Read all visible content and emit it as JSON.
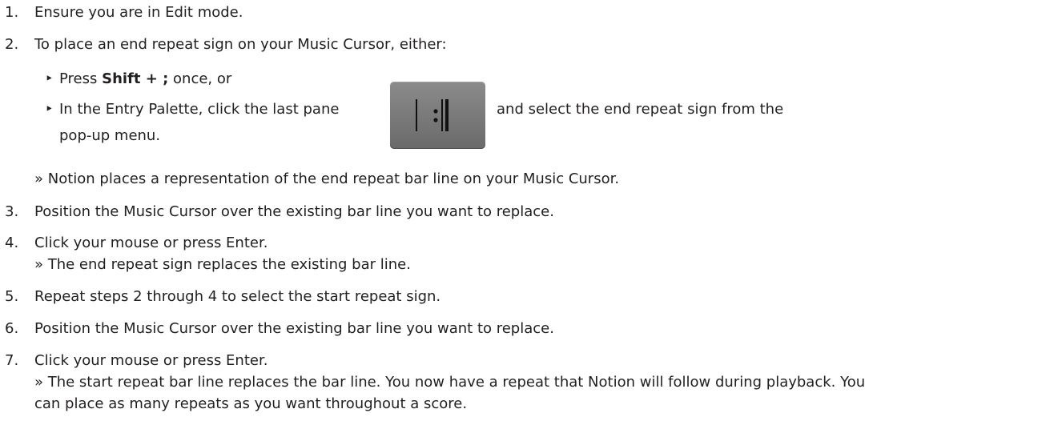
{
  "steps": [
    {
      "num": "1.",
      "text": "Ensure you are in Edit mode."
    },
    {
      "num": "2.",
      "text": "To place an end repeat sign on your Music Cursor, either:"
    },
    {
      "num": "3.",
      "text": "Position the Music Cursor over the existing bar line you want to replace."
    },
    {
      "num": "4.",
      "text": "Click your mouse or press Enter.",
      "result": "» The end repeat sign replaces the existing bar line."
    },
    {
      "num": "5.",
      "text": "Repeat steps 2 through 4 to select the start repeat sign."
    },
    {
      "num": "6.",
      "text": "Position the Music Cursor over the existing bar line you want to replace."
    },
    {
      "num": "7.",
      "text": "Click your mouse or press Enter.",
      "result_line1": "» The start repeat bar line replaces the bar line. You now have a repeat that Notion will follow during playback. You",
      "result_line2": "can place as many repeats as you want throughout a score."
    }
  ],
  "bullet1": {
    "prefix": "Press ",
    "keys": "Shift + ;",
    "suffix": " once, or"
  },
  "bullet2": {
    "before": "In the Entry Palette, click the last pane",
    "after": "and select the end repeat sign from the",
    "line2": "pop-up menu."
  },
  "step2_result": "» Notion places a representation of the end repeat bar line on your Music Cursor.",
  "bullet_glyph": "‣",
  "icon": {
    "name": "end-repeat-pane-icon",
    "color": "#777777"
  }
}
